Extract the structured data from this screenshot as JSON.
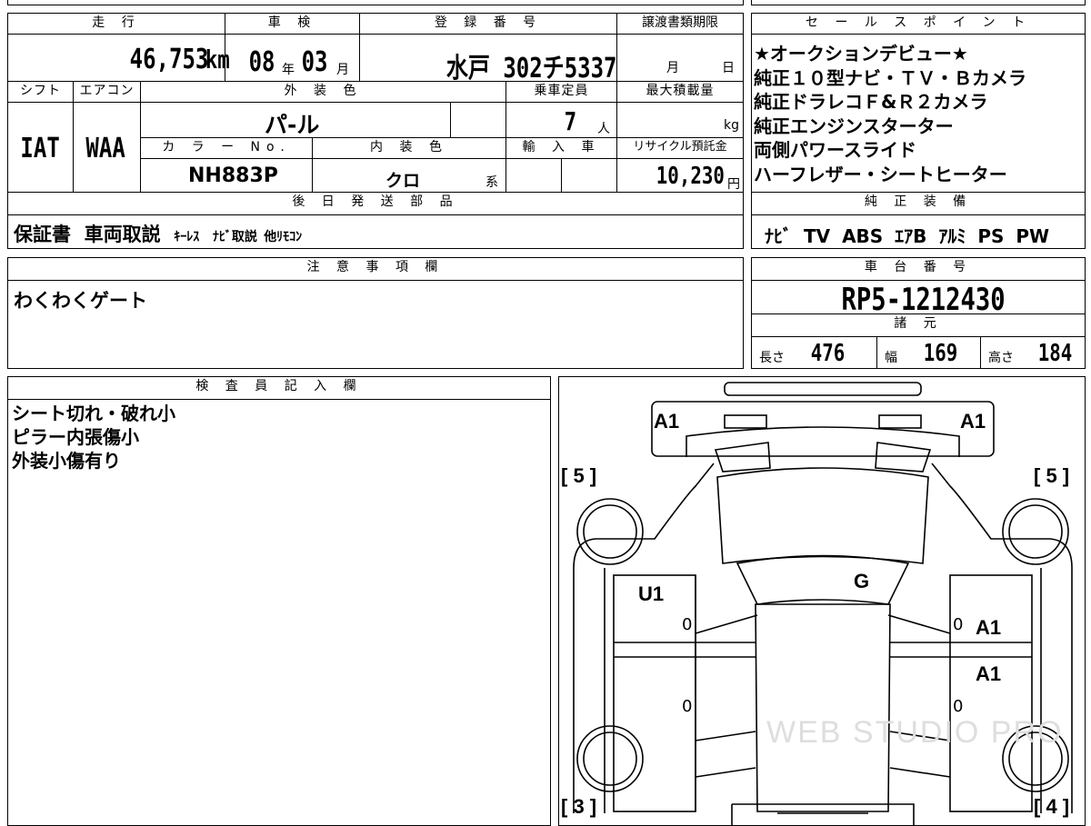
{
  "mileage": {
    "header": "走 行",
    "value": "46,753",
    "unit": "km"
  },
  "inspection": {
    "header": "車 検",
    "year": "08",
    "year_unit": "年",
    "month": "03",
    "month_unit": "月"
  },
  "registration": {
    "header": "登 録 番 号",
    "value": "水戸 302チ5337"
  },
  "transfer_deadline": {
    "header": "譲渡書類期限",
    "month_unit": "月",
    "day_unit": "日"
  },
  "shift": {
    "header": "シフト",
    "value": "IAT"
  },
  "aircon": {
    "header": "エアコン",
    "value": "WAA"
  },
  "exterior_color": {
    "header": "外 装 色",
    "value": "パ-ル"
  },
  "capacity": {
    "header": "乗車定員",
    "value": "7",
    "unit": "人"
  },
  "max_load": {
    "header": "最大積載量",
    "unit": "kg"
  },
  "color_no": {
    "header": "カ ラ ー No.",
    "value": "NH883P"
  },
  "interior_color": {
    "header": "内 装 色",
    "value": "クロ",
    "unit": "系"
  },
  "import": {
    "header": "輸 入 車"
  },
  "recycle": {
    "header": "リサイクル預託金",
    "value": "10,230",
    "unit": "円"
  },
  "sales_points": {
    "header": "セ ー ル ス ポ イ ン ト",
    "lines": [
      "★オークションデビュー★",
      "純正１０型ナビ・ＴＶ・Ｂカメラ",
      "純正ドラレコＦ&Ｒ２カメラ",
      "純正エンジンスターター",
      "両側パワースライド",
      "ハーフレザー・シートヒーター"
    ]
  },
  "later_parts": {
    "header": "後 日 発 送 部 品",
    "items": [
      "保証書",
      "車両取説",
      "ｷｰﾚｽ",
      "ﾅﾋﾞ取説",
      "他ﾘﾓｺﾝ"
    ]
  },
  "equipment": {
    "header": "純 正 装 備",
    "items": [
      "ﾅﾋﾞ",
      "TV",
      "ABS",
      "ｴｱB",
      "ｱﾙﾐ",
      "PS",
      "PW"
    ]
  },
  "notes": {
    "header": "注 意 事 項 欄",
    "text": "わくわくゲート"
  },
  "chassis": {
    "header": "車 台 番 号",
    "value": "RP5-1212430"
  },
  "specs": {
    "header": "諸 元",
    "length_label": "長さ",
    "length": "476",
    "width_label": "幅",
    "width": "169",
    "height_label": "高さ",
    "height": "184"
  },
  "inspector": {
    "header": "検 査 員 記 入 欄",
    "lines": [
      "シート切れ・破れ小",
      "ピラー内張傷小",
      "外装小傷有り"
    ]
  },
  "diagram": {
    "marks": {
      "a1_left": "A1",
      "a1_right": "A1",
      "u1": "U1",
      "g": "G",
      "a1_right_door_front": "A1",
      "a1_right_door_rear": "A1"
    },
    "zeros": {
      "z1": "0",
      "z2": "0",
      "z3": "0",
      "z4": "0"
    },
    "brackets": {
      "tl": "[ 5 ]",
      "tr": "[ 5 ]",
      "bl": "[ 3 ]",
      "br": "[ 4 ]"
    },
    "watermark": "WEB STUDIO PRO"
  }
}
